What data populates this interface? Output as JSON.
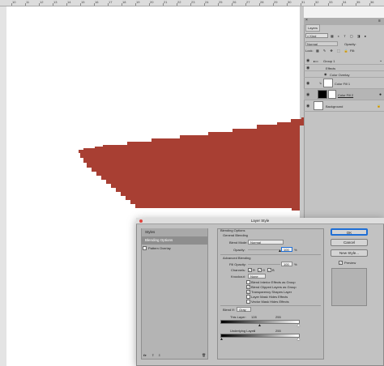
{
  "ruler": {
    "labels": [
      "10",
      "11",
      "12",
      "13",
      "14",
      "15",
      "16",
      "17",
      "18",
      "19",
      "20",
      "21",
      "22",
      "23",
      "24",
      "25",
      "26",
      "27",
      "28",
      "29",
      "30",
      "31",
      "32",
      "33",
      "34",
      "35",
      "36"
    ]
  },
  "layers_panel": {
    "tab": "Layers",
    "kind_filter": "Kind",
    "blend_mode": "Normal",
    "opacity_label": "Opacity:",
    "lock_label": "Lock:",
    "fill_label": "Fill:",
    "rows": [
      {
        "name": "Group 1"
      },
      {
        "name": "Effects"
      },
      {
        "name": "Color Overlay"
      },
      {
        "name": "Color Fill 1"
      },
      {
        "name": "Color Fill 2"
      },
      {
        "name": "Background"
      }
    ]
  },
  "dialog": {
    "title": "Layer Style",
    "styles_header": "Styles",
    "styles_items": [
      "Blending Options",
      "Pattern Overlay"
    ],
    "blending_options": "Blending Options",
    "general_blending": "General Blending",
    "blend_mode_label": "Blend Mode:",
    "blend_mode_value": "Normal",
    "opacity_label": "Opacity:",
    "opacity_value": "100",
    "percent": "%",
    "advanced_blending": "Advanced Blending",
    "fill_opacity_label": "Fill Opacity:",
    "fill_opacity_value": "100",
    "channels_label": "Channels:",
    "channels": [
      "R",
      "G",
      "B"
    ],
    "knockout_label": "Knockout:",
    "knockout_value": "None",
    "checkboxes": [
      {
        "label": "Blend Interior Effects as Group",
        "checked": false
      },
      {
        "label": "Blend Clipped Layers as Group",
        "checked": true
      },
      {
        "label": "Transparency Shapes Layer",
        "checked": true
      },
      {
        "label": "Layer Mask Hides Effects",
        "checked": false
      },
      {
        "label": "Vector Mask Hides Effects",
        "checked": false
      }
    ],
    "blend_if_label": "Blend If:",
    "blend_if_value": "Gray",
    "this_layer_label": "This Layer:",
    "this_layer_lo": "128",
    "this_layer_hi": "255",
    "underlying_label": "Underlying Layer:",
    "underlying_lo": "0",
    "underlying_hi": "255",
    "buttons": {
      "ok": "OK",
      "cancel": "Cancel",
      "new_style": "New Style..."
    },
    "preview_label": "Preview",
    "fx_label": "fx"
  },
  "colors": {
    "shape": "#a83f33",
    "preview_swatch": "#b3b3b3",
    "accent": "#1f6fd6"
  }
}
